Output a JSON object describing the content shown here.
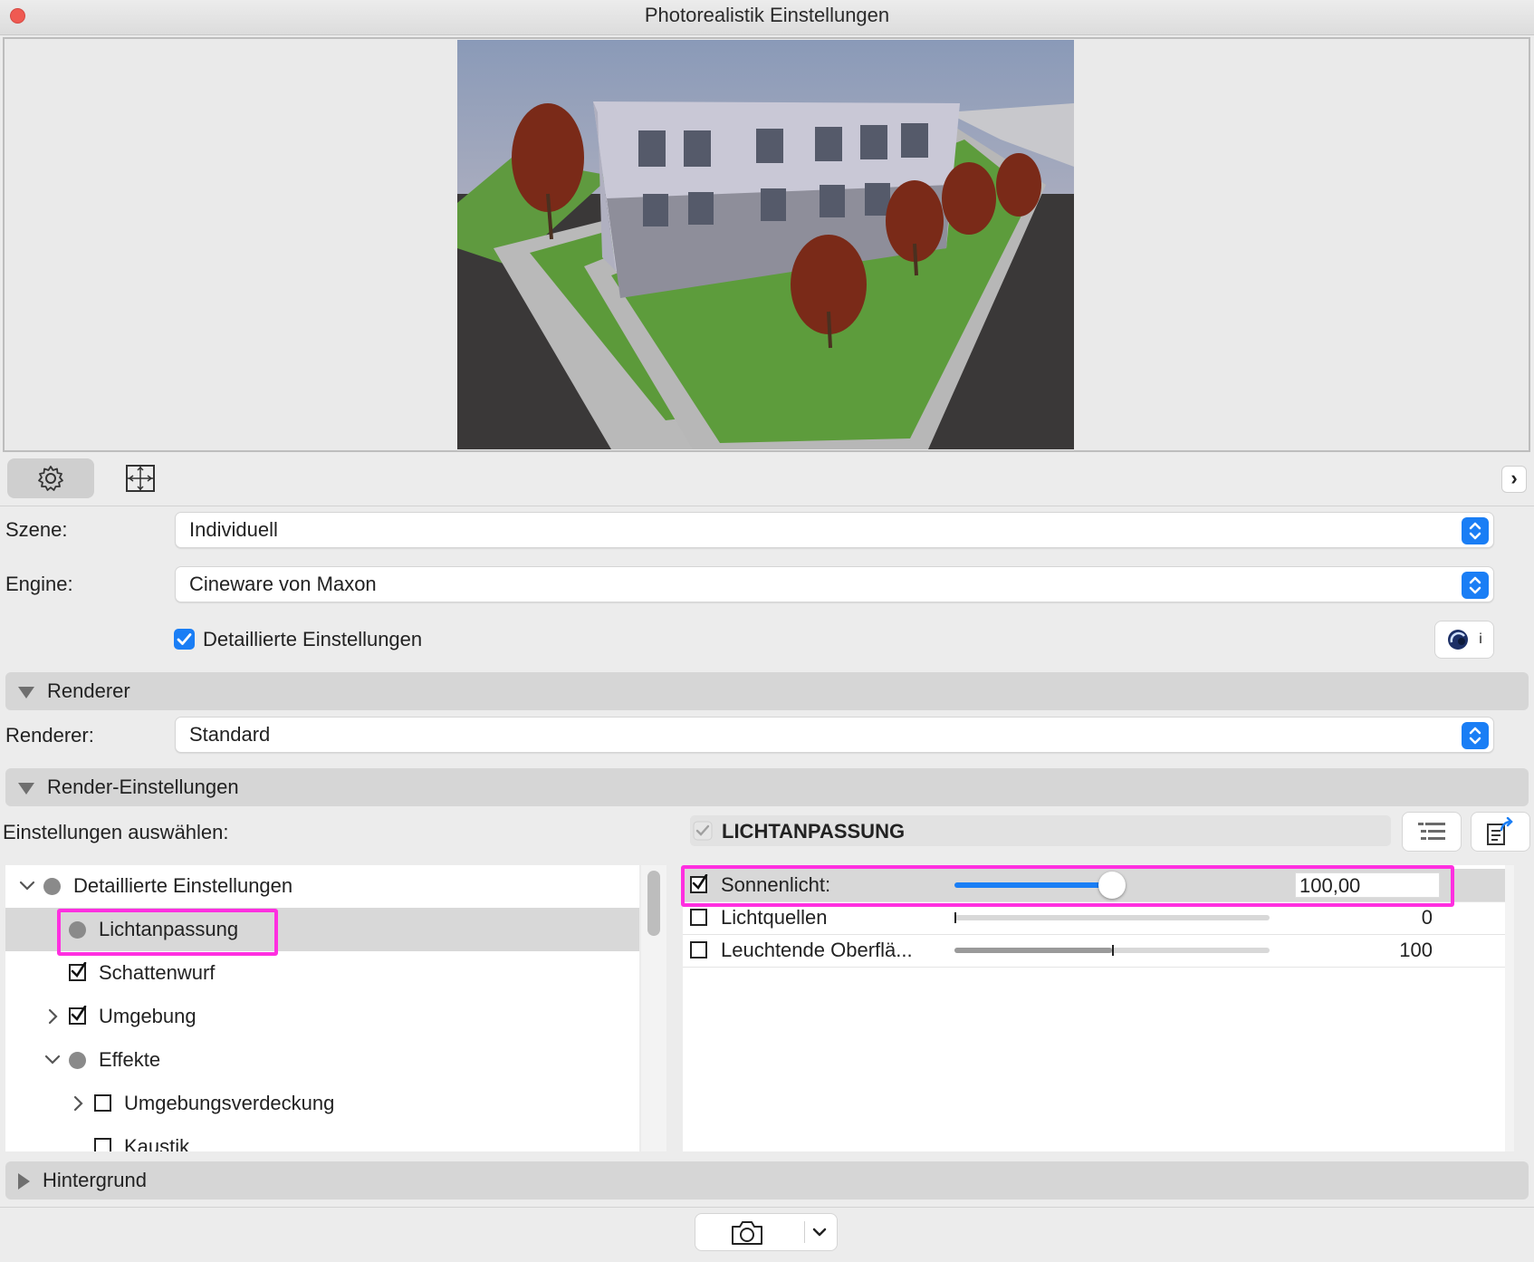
{
  "window": {
    "title": "Photorealistik Einstellungen"
  },
  "toolbar": {
    "expand_glyph": "›"
  },
  "form": {
    "szene_label": "Szene:",
    "szene_value": "Individuell",
    "engine_label": "Engine:",
    "engine_value": "Cineware von Maxon",
    "detailed_label": "Detaillierte Einstellungen",
    "detailed_checked": true,
    "info_glyph": "i"
  },
  "sections": {
    "renderer": "Renderer",
    "render_settings": "Render-Einstellungen",
    "background": "Hintergrund"
  },
  "renderer": {
    "label": "Renderer:",
    "value": "Standard"
  },
  "settings": {
    "select_label": "Einstellungen auswählen:",
    "panel_title": "LICHTANPASSUNG"
  },
  "tree": [
    {
      "label": "Detaillierte Einstellungen",
      "kind": "dot",
      "chevron": "down",
      "depth": 0
    },
    {
      "label": "Lichtanpassung",
      "kind": "dot",
      "chevron": "",
      "depth": 1,
      "selected": true
    },
    {
      "label": "Schattenwurf",
      "kind": "checked",
      "chevron": "",
      "depth": 1
    },
    {
      "label": "Umgebung",
      "kind": "checked",
      "chevron": "right",
      "depth": 1
    },
    {
      "label": "Effekte",
      "kind": "dot",
      "chevron": "down",
      "depth": 1
    },
    {
      "label": "Umgebungsverdeckung",
      "kind": "unchecked",
      "chevron": "right",
      "depth": 2
    },
    {
      "label": "Kaustik",
      "kind": "unchecked",
      "chevron": "",
      "depth": 2
    }
  ],
  "props": [
    {
      "label": "Sonnenlicht:",
      "value": "100,00",
      "slider": 0.5,
      "checked": true,
      "selected": true
    },
    {
      "label": "Lichtquellen",
      "value": "0",
      "slider": 0.0,
      "checked": false
    },
    {
      "label": "Leuchtende Oberflä...",
      "value": "100",
      "slider": 0.5,
      "checked": false
    }
  ],
  "colors": {
    "accent": "#1a7ef5",
    "highlight": "#ff2fe0",
    "close": "#ef5a52"
  },
  "icons": [
    "gear-icon",
    "frame-icon",
    "chevron-right-icon",
    "cineware-icon",
    "list-icon",
    "export-icon",
    "camera-icon",
    "chevron-down-icon"
  ]
}
